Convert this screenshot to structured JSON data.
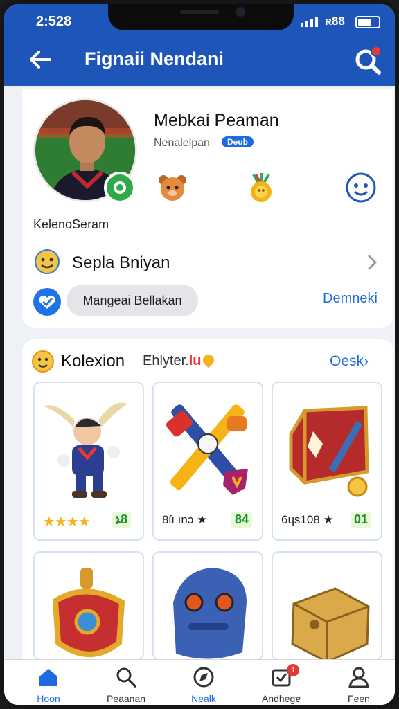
{
  "status": {
    "time": "2:528",
    "network": "ʀ88"
  },
  "header": {
    "title": "Fignaii Nendani"
  },
  "profile": {
    "name": "Mebkai Peaman",
    "subtitle": "Nenalelpan",
    "pill": "Deub",
    "handle": "KelenoSeram",
    "row1_label": "Sepla Bniyan",
    "chip_label": "Mangeai Bellakan",
    "row2_link": "Demneki"
  },
  "collection": {
    "title": "Kolexion",
    "subtitle": "Ehlyter.",
    "subtitle_accent": "lu",
    "more": "Oesk›",
    "items": [
      {
        "rating": "",
        "stars": "★★★★",
        "score": "ኔ8",
        "icon": "jester-character"
      },
      {
        "rating": "8ſı ınɔ ★",
        "score": "84",
        "icon": "crossed-weapons"
      },
      {
        "rating": "6ɥs108 ★",
        "score": "01",
        "icon": "treasure-chest"
      },
      {
        "icon": "golden-shield"
      },
      {
        "icon": "blue-mask"
      },
      {
        "icon": "gold-box"
      }
    ]
  },
  "nav": [
    {
      "label": "Hoon",
      "icon": "home-icon",
      "active": true
    },
    {
      "label": "Peaanan",
      "icon": "search-icon"
    },
    {
      "label": "Nealk",
      "icon": "compass-icon",
      "active": true
    },
    {
      "label": "Andhegɐ",
      "icon": "inbox-icon",
      "badge": "1"
    },
    {
      "label": "Feen",
      "icon": "person-icon"
    }
  ],
  "colors": {
    "brand": "#1e55b8",
    "accent": "#1e6be0",
    "score_green": "#1d8f27",
    "badge_red": "#e53935"
  }
}
